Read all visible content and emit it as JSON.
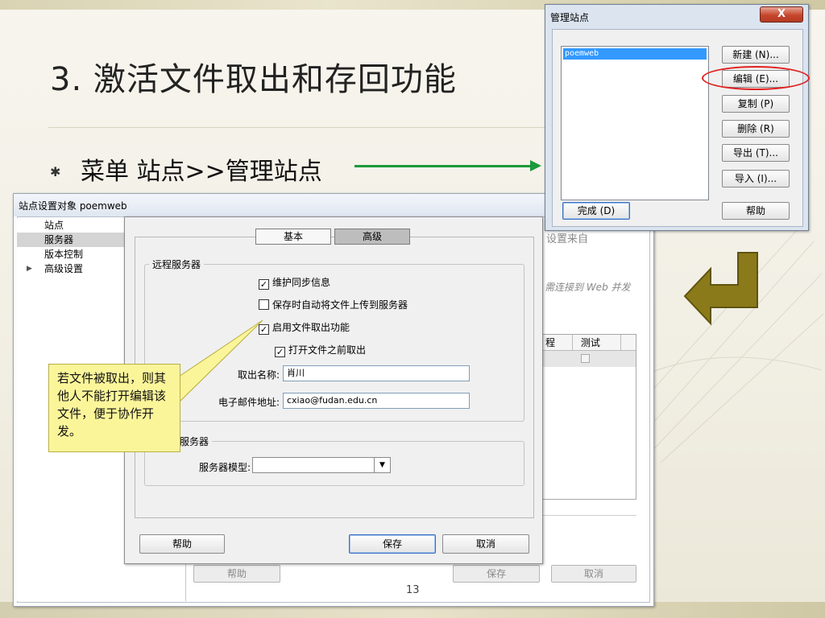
{
  "slide": {
    "title": "3. 激活文件取出和存回功能",
    "bullet_text": "菜单 站点>>管理站点",
    "page_number": "13",
    "callout_text": "若文件被取出，则其他人不能打开编辑该文件，便于协作开发。",
    "colors": {
      "arrow_green": "#1a9a3a",
      "highlight_red": "#e02020",
      "callout_bg": "#fbf59a",
      "olive_arrow": "#8a7a1a"
    }
  },
  "manage_sites": {
    "title": "管理站点",
    "close_icon": "x-icon",
    "close_label": "X",
    "sites": [
      "poemweb"
    ],
    "buttons": {
      "new": "新建 (N)...",
      "edit": "编辑 (E)...",
      "copy": "复制 (P)",
      "delete": "删除 (R)",
      "export": "导出 (T)...",
      "import": "导入 (I)...",
      "done": "完成 (D)",
      "help": "帮助"
    }
  },
  "site_setup": {
    "title": "站点设置对象 poemweb",
    "sidebar": [
      "站点",
      "服务器",
      "版本控制",
      "高级设置"
    ],
    "selected_sidebar": "服务器",
    "background_text_1": "设置来自",
    "background_text_2": "需连接到 Web 并发",
    "table_headers": [
      "程",
      "测试"
    ],
    "bottom_buttons": {
      "help": "帮助",
      "save": "保存",
      "cancel": "取消"
    }
  },
  "server_dialog": {
    "tabs": [
      "基本",
      "高级"
    ],
    "active_tab": "高级",
    "remote_group_label": "远程服务器",
    "checkboxes": [
      {
        "label": "维护同步信息",
        "checked": true
      },
      {
        "label": "保存时自动将文件上传到服务器",
        "checked": false
      },
      {
        "label": "启用文件取出功能",
        "checked": true
      },
      {
        "label": "打开文件之前取出",
        "checked": true
      }
    ],
    "checkout_name_label": "取出名称:",
    "checkout_name_value": "肖川",
    "email_label": "电子邮件地址:",
    "email_value": "cxiao@fudan.edu.cn",
    "testing_group_label": "服务器",
    "server_model_label": "服务器模型:",
    "server_model_value": "",
    "buttons": {
      "help": "帮助",
      "save": "保存",
      "cancel": "取消"
    }
  }
}
